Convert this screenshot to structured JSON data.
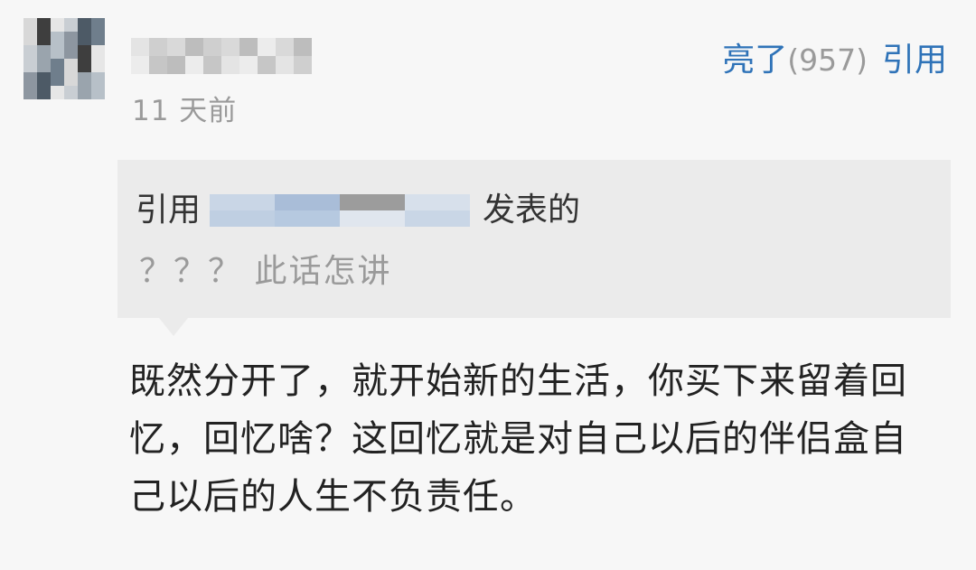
{
  "comment": {
    "time": "11 天前",
    "like_label": "亮了",
    "like_count": "(957)",
    "quote_button": "引用",
    "quote": {
      "prefix": "引用",
      "suffix": "发表的",
      "text": "？？？ 此话怎讲"
    },
    "text": "既然分开了，就开始新的生活，你买下来留着回忆，回忆啥？这回忆就是对自己以后的伴侣盒自己以后的人生不负责任。"
  },
  "colors": {
    "background": "#f7f7f7",
    "link": "#2f73b8",
    "muted": "#9a9a9a",
    "quote_bg": "#ebebeb",
    "text": "#222222"
  }
}
